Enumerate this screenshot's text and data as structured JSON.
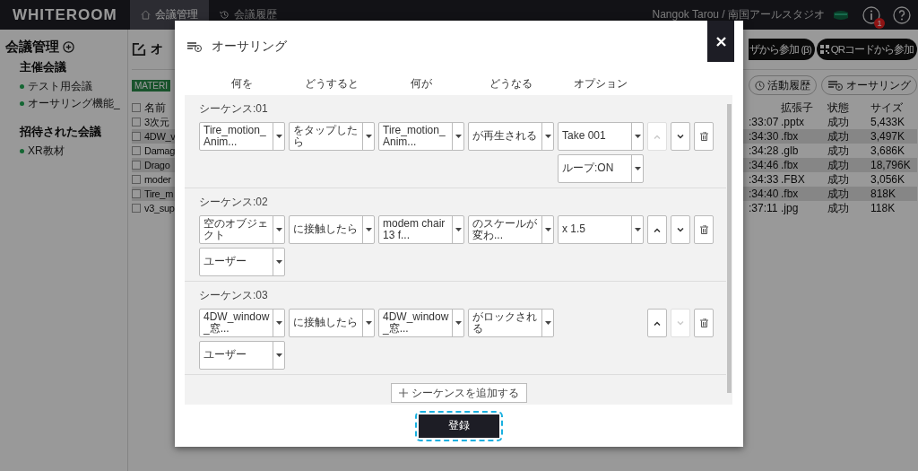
{
  "header": {
    "logo": "WHITEROOM",
    "nav": [
      {
        "label": "会議管理",
        "selected": true
      },
      {
        "label": "会議履歴",
        "selected": false
      }
    ],
    "user": "Nangok Tarou / 南国アールスタジオ",
    "notification_badge": "1"
  },
  "sidebar": {
    "title": "会議管理",
    "sections": [
      {
        "heading": "主催会議",
        "items": [
          "テスト用会議",
          "オーサリング機能_"
        ]
      },
      {
        "heading": "招待された会議",
        "items": [
          "XR教材"
        ]
      }
    ]
  },
  "main": {
    "title": "オ",
    "tag": "MATERI",
    "join_buttons": [
      {
        "kind": "browser",
        "label": "ザから参加 (β)"
      },
      {
        "kind": "qr",
        "label": "QRコードから参加"
      }
    ],
    "tool_buttons": [
      {
        "kind": "history",
        "label": "活動履歴"
      },
      {
        "kind": "authoring",
        "label": "オーサリング"
      }
    ],
    "table": {
      "select_all_checked": false,
      "columns": {
        "name": "名前",
        "ext": "拡張子",
        "status": "状態",
        "size": "サイズ"
      },
      "rows": [
        {
          "checked": false,
          "name": "3次元",
          "column_2": ":33:07",
          "ext": ".pptx",
          "status": "成功",
          "size": "5,433K"
        },
        {
          "checked": false,
          "name": "4DW_v",
          "column_2": ":34:30",
          "ext": ".fbx",
          "status": "成功",
          "size": "3,497K"
        },
        {
          "checked": false,
          "name": "Damag",
          "column_2": ":34:28",
          "ext": ".glb",
          "status": "成功",
          "size": "3,686K"
        },
        {
          "checked": false,
          "name": "Drago",
          "column_2": ":34:46",
          "ext": ".fbx",
          "status": "成功",
          "size": "18,796K"
        },
        {
          "checked": false,
          "name": "moder",
          "column_2": ":34:33",
          "ext": ".FBX",
          "status": "成功",
          "size": "3,056K"
        },
        {
          "checked": false,
          "name": "Tire_m",
          "column_2": ":34:40",
          "ext": ".fbx",
          "status": "成功",
          "size": "818K"
        },
        {
          "checked": false,
          "name": "v3_sup",
          "column_2": ":37:11",
          "ext": ".jpg",
          "status": "成功",
          "size": "118K"
        }
      ]
    }
  },
  "dialog": {
    "title": "オーサリング",
    "columns": [
      "何を",
      "どうすると",
      "何が",
      "どうなる",
      "オプション"
    ],
    "sequences": [
      {
        "label": "シーケンス:01",
        "first_row": [
          "Tire_motion_Anim...",
          "をタップしたら",
          "Tire_motion_Anim...",
          "が再生される",
          "Take 001"
        ],
        "second_row": [
          {
            "kind": "option",
            "value": "ループ:ON"
          }
        ],
        "move_up": {
          "disabled": true
        },
        "move_down": {
          "disabled": false
        }
      },
      {
        "label": "シーケンス:02",
        "first_row": [
          "空のオブジェクト",
          "に接触したら",
          "modem chair 13 f...",
          "のスケールが変わ...",
          "x 1.5"
        ],
        "second_row": [
          {
            "kind": "subject",
            "value": "ユーザー"
          }
        ],
        "move_up": {
          "disabled": false
        },
        "move_down": {
          "disabled": false
        }
      },
      {
        "label": "シーケンス:03",
        "first_row": [
          "4DW_window_窓...",
          "に接触したら",
          "4DW_window_窓...",
          "がロックされる"
        ],
        "second_row": [
          {
            "kind": "subject",
            "value": "ユーザー"
          }
        ],
        "move_up": {
          "disabled": false
        },
        "move_down": {
          "disabled": true
        }
      }
    ],
    "add_button": "シーケンスを追加する",
    "submit_button": "登録"
  }
}
